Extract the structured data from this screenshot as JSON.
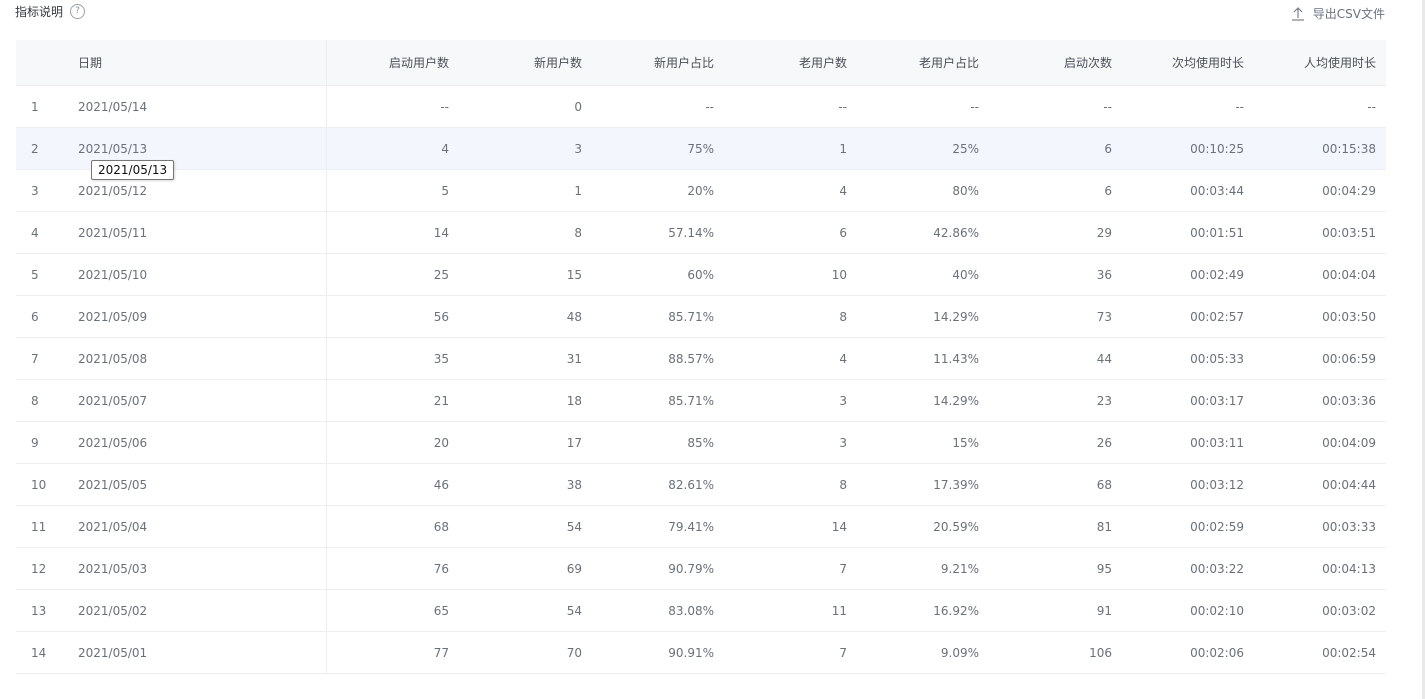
{
  "header": {
    "title": "指标说明",
    "help_icon": "?",
    "export_label": "导出CSV文件"
  },
  "table": {
    "columns": [
      "",
      "日期",
      "启动用户数",
      "新用户数",
      "新用户占比",
      "老用户数",
      "老用户占比",
      "启动次数",
      "次均使用时长",
      "人均使用时长"
    ],
    "rows": [
      [
        "1",
        "2021/05/14",
        "--",
        "0",
        "--",
        "--",
        "--",
        "--",
        "--",
        "--"
      ],
      [
        "2",
        "2021/05/13",
        "4",
        "3",
        "75%",
        "1",
        "25%",
        "6",
        "00:10:25",
        "00:15:38"
      ],
      [
        "3",
        "2021/05/12",
        "5",
        "1",
        "20%",
        "4",
        "80%",
        "6",
        "00:03:44",
        "00:04:29"
      ],
      [
        "4",
        "2021/05/11",
        "14",
        "8",
        "57.14%",
        "6",
        "42.86%",
        "29",
        "00:01:51",
        "00:03:51"
      ],
      [
        "5",
        "2021/05/10",
        "25",
        "15",
        "60%",
        "10",
        "40%",
        "36",
        "00:02:49",
        "00:04:04"
      ],
      [
        "6",
        "2021/05/09",
        "56",
        "48",
        "85.71%",
        "8",
        "14.29%",
        "73",
        "00:02:57",
        "00:03:50"
      ],
      [
        "7",
        "2021/05/08",
        "35",
        "31",
        "88.57%",
        "4",
        "11.43%",
        "44",
        "00:05:33",
        "00:06:59"
      ],
      [
        "8",
        "2021/05/07",
        "21",
        "18",
        "85.71%",
        "3",
        "14.29%",
        "23",
        "00:03:17",
        "00:03:36"
      ],
      [
        "9",
        "2021/05/06",
        "20",
        "17",
        "85%",
        "3",
        "15%",
        "26",
        "00:03:11",
        "00:04:09"
      ],
      [
        "10",
        "2021/05/05",
        "46",
        "38",
        "82.61%",
        "8",
        "17.39%",
        "68",
        "00:03:12",
        "00:04:44"
      ],
      [
        "11",
        "2021/05/04",
        "68",
        "54",
        "79.41%",
        "14",
        "20.59%",
        "81",
        "00:02:59",
        "00:03:33"
      ],
      [
        "12",
        "2021/05/03",
        "76",
        "69",
        "90.79%",
        "7",
        "9.21%",
        "95",
        "00:03:22",
        "00:04:13"
      ],
      [
        "13",
        "2021/05/02",
        "65",
        "54",
        "83.08%",
        "11",
        "16.92%",
        "91",
        "00:02:10",
        "00:03:02"
      ],
      [
        "14",
        "2021/05/01",
        "77",
        "70",
        "90.91%",
        "7",
        "9.09%",
        "106",
        "00:02:06",
        "00:02:54"
      ]
    ],
    "hovered_row": 1
  },
  "tooltip": {
    "text": "2021/05/13"
  },
  "icons": {
    "help": "help-circle-icon",
    "export": "upload-arrow-icon"
  }
}
